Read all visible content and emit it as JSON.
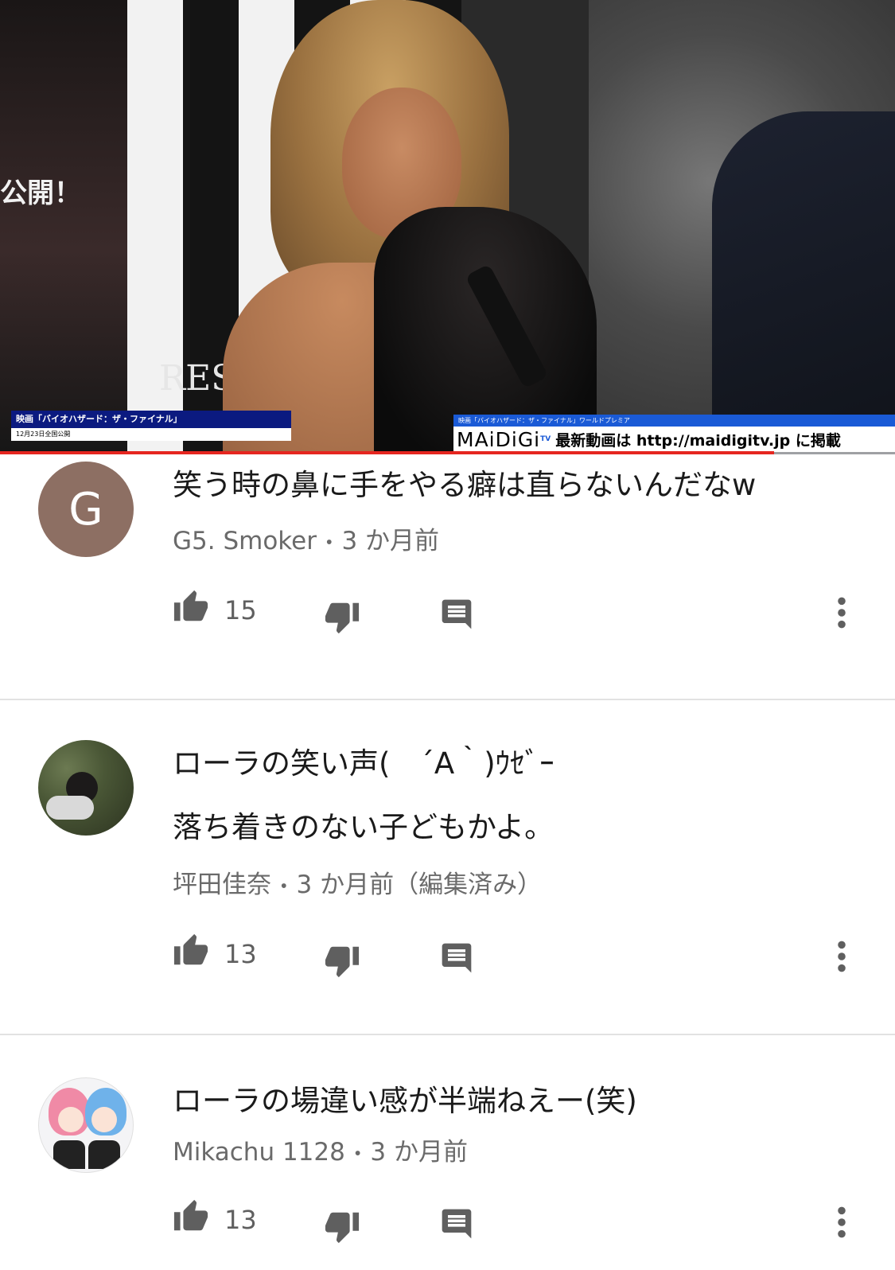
{
  "video": {
    "caption_left_title": "映画「バイオハザード：ザ・ファイナル」",
    "caption_left_sub": "12月23日全国公開",
    "caption_right_title": "映画「バイオハザード：ザ・ファイナル」ワールドプレミア",
    "brand": "MAiDiGi",
    "brand_tv": "TV",
    "caption_right_msg": "最新動画は http://maidigitv.jp に掲載",
    "bg_text_left": "公開！",
    "bg_text_res": "RES",
    "progress": 0.865,
    "progress_color": "#e52620"
  },
  "comments": [
    {
      "avatar_letter": "G",
      "avatar_color": "#8d6f63",
      "lines": [
        "笑う時の鼻に手をやる癖は直らないんだなw"
      ],
      "author": "G5. Smoker",
      "time": "3 か月前",
      "likes": "15"
    },
    {
      "avatar_icon": "photo-avatar",
      "lines": [
        "ローラの笑い声(　´A｀)ｳｾﾞｰ",
        "落ち着きのない子どもかよ。"
      ],
      "author": "坪田佳奈",
      "time": "3 か月前（編集済み）",
      "likes": "13"
    },
    {
      "avatar_icon": "anime-avatar",
      "lines": [
        "ローラの場違い感が半端ねえー(笑)"
      ],
      "author": "Mikachu 1128",
      "time": "3 か月前",
      "likes": "13"
    }
  ],
  "meta_separator": "•",
  "icons": {
    "like": "thumb-up-icon",
    "dislike": "thumb-down-icon",
    "reply": "comment-icon",
    "more": "more-vertical-icon"
  }
}
